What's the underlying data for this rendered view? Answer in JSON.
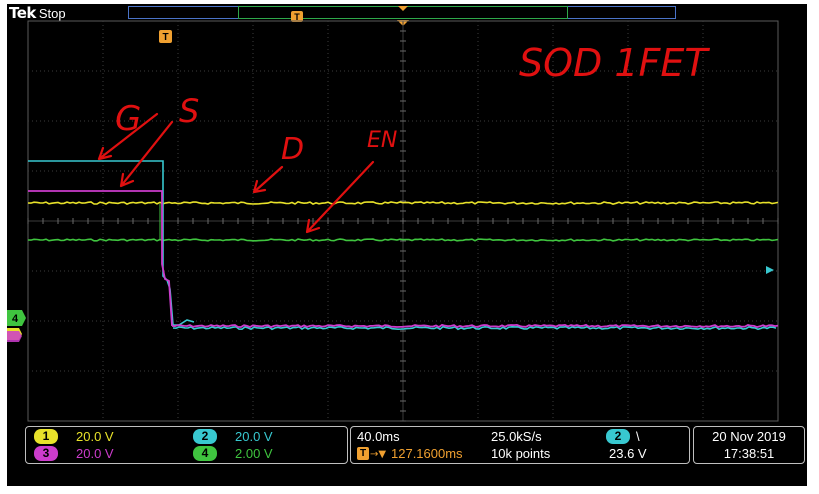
{
  "header": {
    "brand": "Tek",
    "run_state": "Stop",
    "trigger_marker": "T"
  },
  "colors": {
    "ch1": "#e8e22a",
    "ch2": "#38c8d0",
    "ch3": "#cc3ccc",
    "ch4": "#3fc43f",
    "trigger": "#f0a030",
    "annotation": "#e01010"
  },
  "annotations": {
    "title": "SOD 1FET",
    "g": "G",
    "s": "S",
    "d": "D",
    "en": "EN"
  },
  "status": {
    "ch1": {
      "num": "1",
      "scale": "20.0 V"
    },
    "ch2": {
      "num": "2",
      "scale": "20.0 V"
    },
    "ch3": {
      "num": "3",
      "scale": "20.0 V"
    },
    "ch4": {
      "num": "4",
      "scale": "2.00 V"
    },
    "timebase": "40.0ms",
    "sample_rate": "25.0kS/s",
    "trigger_pos": "127.1600ms",
    "record_len": "10k points",
    "trigger_source": "2",
    "trigger_slope": "\\",
    "trigger_level": "23.6 V",
    "date": "20 Nov 2019",
    "time": "17:38:51"
  }
}
